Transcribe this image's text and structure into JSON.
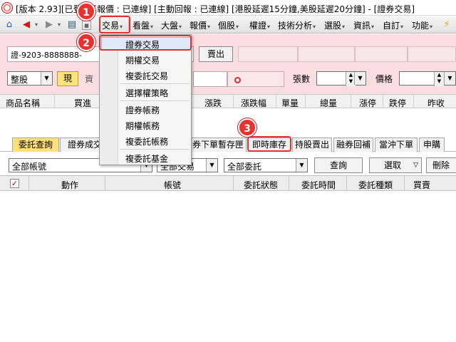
{
  "window": {
    "title": "[版本 2.93][已登入][報價 : 已連線] [主動回報 : 已連線] [港股延遲15分鐘,美股延遲20分鐘] - [證券交易]"
  },
  "menubar": {
    "items": [
      "交易",
      "看盤",
      "大盤",
      "報價",
      "個股",
      "權證",
      "技術分析",
      "選股",
      "資訊",
      "自訂",
      "功能"
    ]
  },
  "order": {
    "account": "證-9203-8888888-",
    "sell_label": "賣出",
    "market_select": "整股",
    "cash_label": "現",
    "funding_label": "資",
    "qty_label": "張數",
    "price_label": "價格"
  },
  "quote_header": {
    "columns": [
      "商品名稱",
      "買進",
      "漲跌",
      "漲跌幅",
      "單量",
      "總量",
      "漲停",
      "跌停",
      "昨收"
    ]
  },
  "tabs": [
    "委託查詢",
    "證券成交",
    "券下單暫存匣",
    "即時庫存",
    "持股賣出",
    "融券回補",
    "當沖下單",
    "申購"
  ],
  "filters": {
    "account": "全部帳號",
    "trade_type": "全部交易",
    "order_status": "全部委託",
    "query_label": "查詢",
    "select_label": "選取",
    "delete_label": "刪除"
  },
  "orders_header": {
    "columns": [
      "動作",
      "帳號",
      "委託狀態",
      "委託時間",
      "委託種類",
      "買賣"
    ]
  },
  "dropdown": {
    "items": [
      "證券交易",
      "期權交易",
      "複委託交易",
      "選擇權策略",
      "證券帳務",
      "期權帳務",
      "複委託帳務",
      "複委託基金"
    ],
    "highlighted": "證券交易"
  },
  "annotations": [
    "1",
    "2",
    "3"
  ],
  "colors": {
    "order_panel_bg": "#fadde1",
    "active_tab_bg": "#ffe07a",
    "callout_red": "#e8322f",
    "menu_highlight": "#dfe9f7"
  }
}
